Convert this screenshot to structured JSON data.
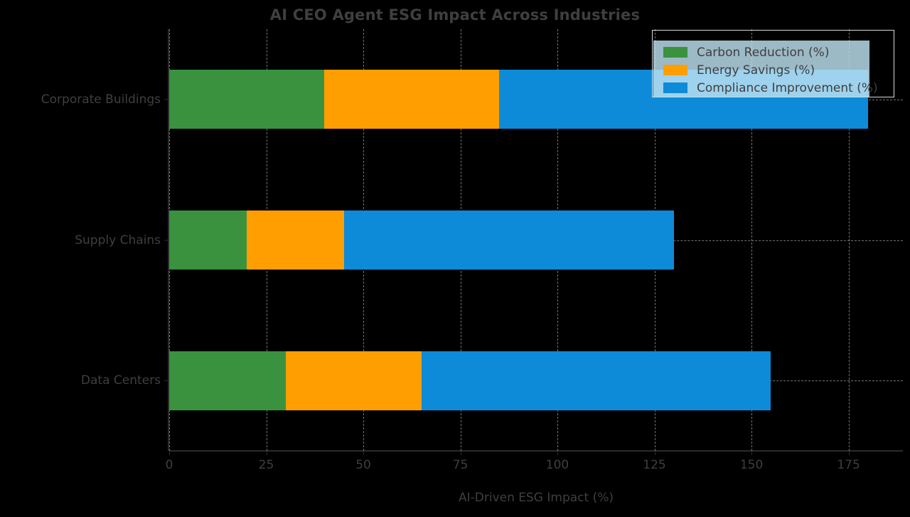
{
  "chart_data": {
    "type": "bar",
    "orientation": "horizontal",
    "stacked": true,
    "title": "AI CEO Agent ESG Impact Across Industries",
    "xlabel": "AI-Driven ESG Impact (%)",
    "ylabel": "",
    "categories": [
      "Corporate Buildings",
      "Supply Chains",
      "Data Centers"
    ],
    "series": [
      {
        "name": "Carbon Reduction (%)",
        "color": "#3a923f",
        "values": [
          40,
          20,
          30
        ]
      },
      {
        "name": "Energy Savings (%)",
        "color": "#ff9e01",
        "values": [
          45,
          25,
          35
        ]
      },
      {
        "name": "Compliance Improvement (%)",
        "color": "#0d8bd9",
        "values": [
          95,
          85,
          90
        ]
      }
    ],
    "totals": [
      180,
      130,
      155
    ],
    "xlim": [
      0,
      189
    ],
    "xticks": [
      0,
      25,
      50,
      75,
      100,
      125,
      150,
      175
    ],
    "xtick_labels": [
      "0",
      "25",
      "50",
      "75",
      "100",
      "125",
      "150",
      "175"
    ],
    "grid": true,
    "grid_style": "dashed",
    "legend_position": "upper right",
    "background": "#000000",
    "text_color": "#3f3f3f",
    "axis_color": "#2b2b2b",
    "grid_color": "#cfcfcf",
    "legend_face_color": "#bee2f2",
    "legend_edge_color": "#d9d9d9"
  }
}
